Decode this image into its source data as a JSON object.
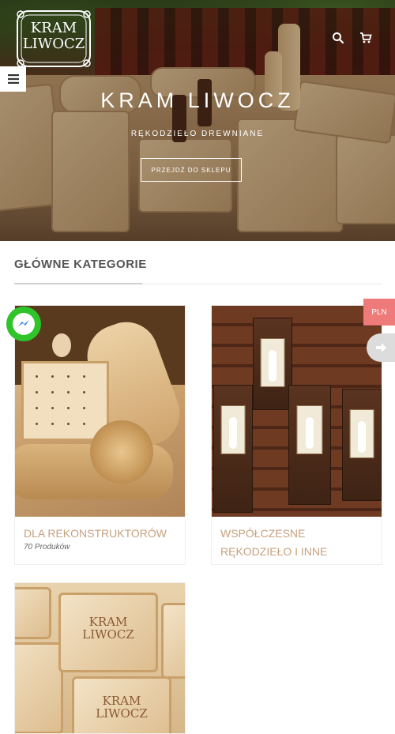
{
  "header": {
    "logo_text": [
      "KRAM",
      "LIWOCZ"
    ],
    "icons": [
      "search-icon",
      "cart-icon",
      "menu-icon"
    ]
  },
  "hero": {
    "title": "KRAM LIWOCZ",
    "subtitle": "RĘKODZIEŁO DREWNIANE",
    "button": "PRZEJDŹ DO SKLEPU"
  },
  "section": {
    "title": "GŁÓWNE KATEGORIE"
  },
  "categories": [
    {
      "name": "DLA REKONSTRUKTORÓW",
      "count": "70 Produków"
    },
    {
      "name": "WSPÓŁCZESNE RĘKODZIEŁO I INNE ARTYKUŁY"
    },
    {
      "image_text": [
        "KRAM",
        "LIWOCZ"
      ]
    }
  ],
  "floating": {
    "currency": "PLN",
    "icons": [
      "messenger-icon",
      "arrow-right-icon"
    ]
  },
  "colors": {
    "category_name": "#c6a17e",
    "currency_badge": "#ef7a7a",
    "messenger": "#2ec42a"
  }
}
